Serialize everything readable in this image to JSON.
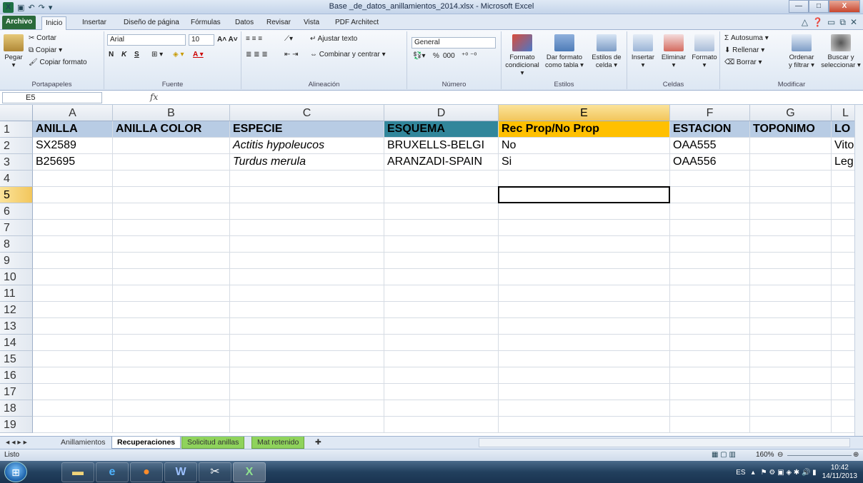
{
  "window": {
    "title": "Base _de_datos_anillamientos_2014.xlsx  -  Microsoft Excel",
    "minimize": "—",
    "maximize": "□",
    "close": "X"
  },
  "ribbon_tabs": [
    "Archivo",
    "Inicio",
    "Insertar",
    "Diseño de página",
    "Fórmulas",
    "Datos",
    "Revisar",
    "Vista",
    "PDF Architect"
  ],
  "ribbon": {
    "portapapeles": {
      "paste": "Pegar",
      "cut": "Cortar",
      "copy": "Copiar",
      "format_painter": "Copiar formato",
      "label": "Portapapeles"
    },
    "fuente": {
      "font": "Arial",
      "size": "10",
      "bold": "N",
      "italic": "K",
      "underline": "S",
      "label": "Fuente"
    },
    "alineacion": {
      "wrap": "Ajustar texto",
      "merge": "Combinar y centrar",
      "label": "Alineación"
    },
    "numero": {
      "format": "General",
      "percent": "%",
      "thousands": "000",
      "label": "Número"
    },
    "estilos": {
      "cond_a": "Formato",
      "cond_b": "condicional",
      "table_a": "Dar formato",
      "table_b": "como tabla",
      "cell_a": "Estilos de",
      "cell_b": "celda",
      "label": "Estilos"
    },
    "celdas": {
      "insert": "Insertar",
      "delete": "Eliminar",
      "format": "Formato",
      "label": "Celdas"
    },
    "modificar": {
      "autosum": "Autosuma",
      "fill": "Rellenar",
      "clear": "Borrar",
      "sort_a": "Ordenar",
      "sort_b": "y filtrar",
      "find_a": "Buscar y",
      "find_b": "seleccionar",
      "label": "Modificar"
    }
  },
  "formula_bar": {
    "namebox": "E5",
    "fx": "fx",
    "value": ""
  },
  "columns": [
    "A",
    "B",
    "C",
    "D",
    "E",
    "F",
    "G",
    "L"
  ],
  "rows": [
    "1",
    "2",
    "3",
    "4",
    "5",
    "6",
    "7",
    "8",
    "9",
    "10",
    "11",
    "12",
    "13",
    "14",
    "15",
    "16",
    "17",
    "18",
    "19"
  ],
  "headers": [
    "ANILLA",
    "ANILLA COLOR",
    "ESPECIE",
    "ESQUEMA",
    "Rec Prop/No Prop",
    "ESTACION",
    "TOPONIMO",
    "LO"
  ],
  "data_rows": [
    [
      "SX2589",
      "",
      "Actitis hypoleucos",
      "BRUXELLS-BELGI",
      "No",
      "OAA555",
      "",
      "Vito"
    ],
    [
      "B25695",
      "",
      "Turdus merula",
      "ARANZADI-SPAIN",
      "Si",
      "OAA556",
      "",
      "Leg"
    ]
  ],
  "sheet_tabs": [
    "Anillamientos",
    "Recuperaciones",
    "Solicitud anillas",
    "Mat retenido"
  ],
  "status": {
    "mode": "Listo",
    "zoom": "160%"
  },
  "taskbar": {
    "lang": "ES",
    "time": "10:42",
    "date": "14/11/2013"
  }
}
